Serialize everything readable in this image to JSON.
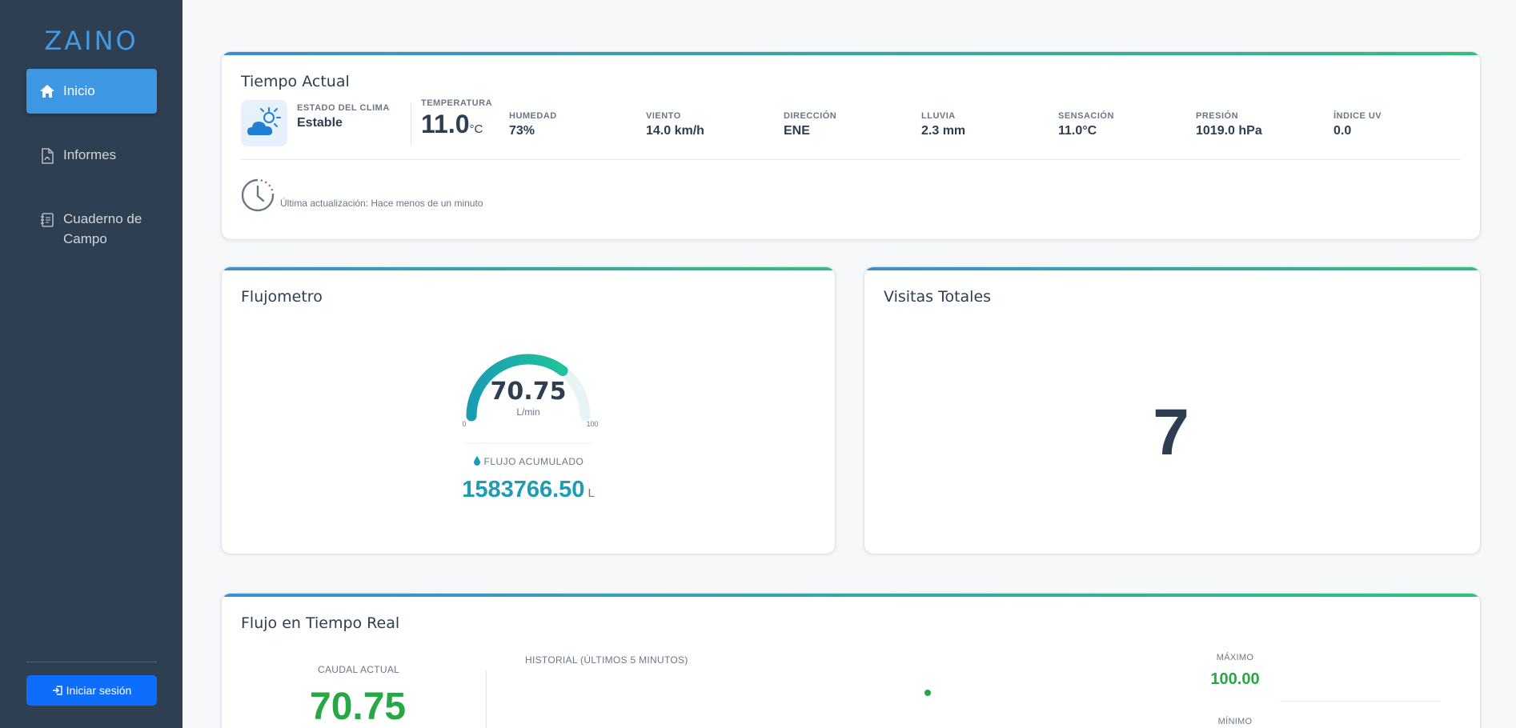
{
  "sidebar": {
    "brand": "ZAINO",
    "items": [
      {
        "label": "Inicio",
        "icon": "home-icon",
        "active": true
      },
      {
        "label": "Informes",
        "icon": "pdf-file-icon",
        "active": false
      },
      {
        "label": "Cuaderno de Campo",
        "icon": "notebook-icon",
        "active": false
      }
    ],
    "login_label": "Iniciar sesión"
  },
  "weather": {
    "title": "Tiempo Actual",
    "icon": "partly-sunny-cloud-icon",
    "estado_label": "ESTADO DEL CLIMA",
    "estado_value": "Estable",
    "temp_label": "TEMPERATURA",
    "temp_value": "11.0",
    "temp_unit": "°C",
    "metrics": [
      {
        "label": "HUMEDAD",
        "value": "73%"
      },
      {
        "label": "VIENTO",
        "value": "14.0 km/h"
      },
      {
        "label": "DIRECCIÓN",
        "value": "ENE"
      },
      {
        "label": "LLUVIA",
        "value": "2.3 mm"
      },
      {
        "label": "SENSACIÓN",
        "value": "11.0°C"
      },
      {
        "label": "PRESIÓN",
        "value": "1019.0 hPa"
      },
      {
        "label": "ÍNDICE UV",
        "value": "0.0"
      }
    ],
    "update_text": "Última actualización: Hace menos de un minuto"
  },
  "flujometro": {
    "title": "Flujometro",
    "gauge_value": "70.75",
    "gauge_fraction": 0.7075,
    "gauge_unit": "L/min",
    "gauge_min": "0",
    "gauge_max": "100",
    "accumulated_label": "FLUJO ACUMULADO",
    "accumulated_value": "1583766.50",
    "accumulated_unit": "L"
  },
  "visitas": {
    "title": "Visitas Totales",
    "value": "7"
  },
  "realtime": {
    "title": "Flujo en Tiempo Real",
    "current_label": "CAUDAL ACTUAL",
    "current_value": "70.75",
    "history_label": "HISTORIAL (ÚLTIMOS 5 MINUTOS)",
    "max_label": "MÁXIMO",
    "max_value": "100.00",
    "min_label": "MÍNIMO"
  },
  "colors": {
    "accent": "#3d97e3",
    "success": "#28a745",
    "gauge": "#1ab3a6",
    "sidebar": "#2f3f52"
  }
}
